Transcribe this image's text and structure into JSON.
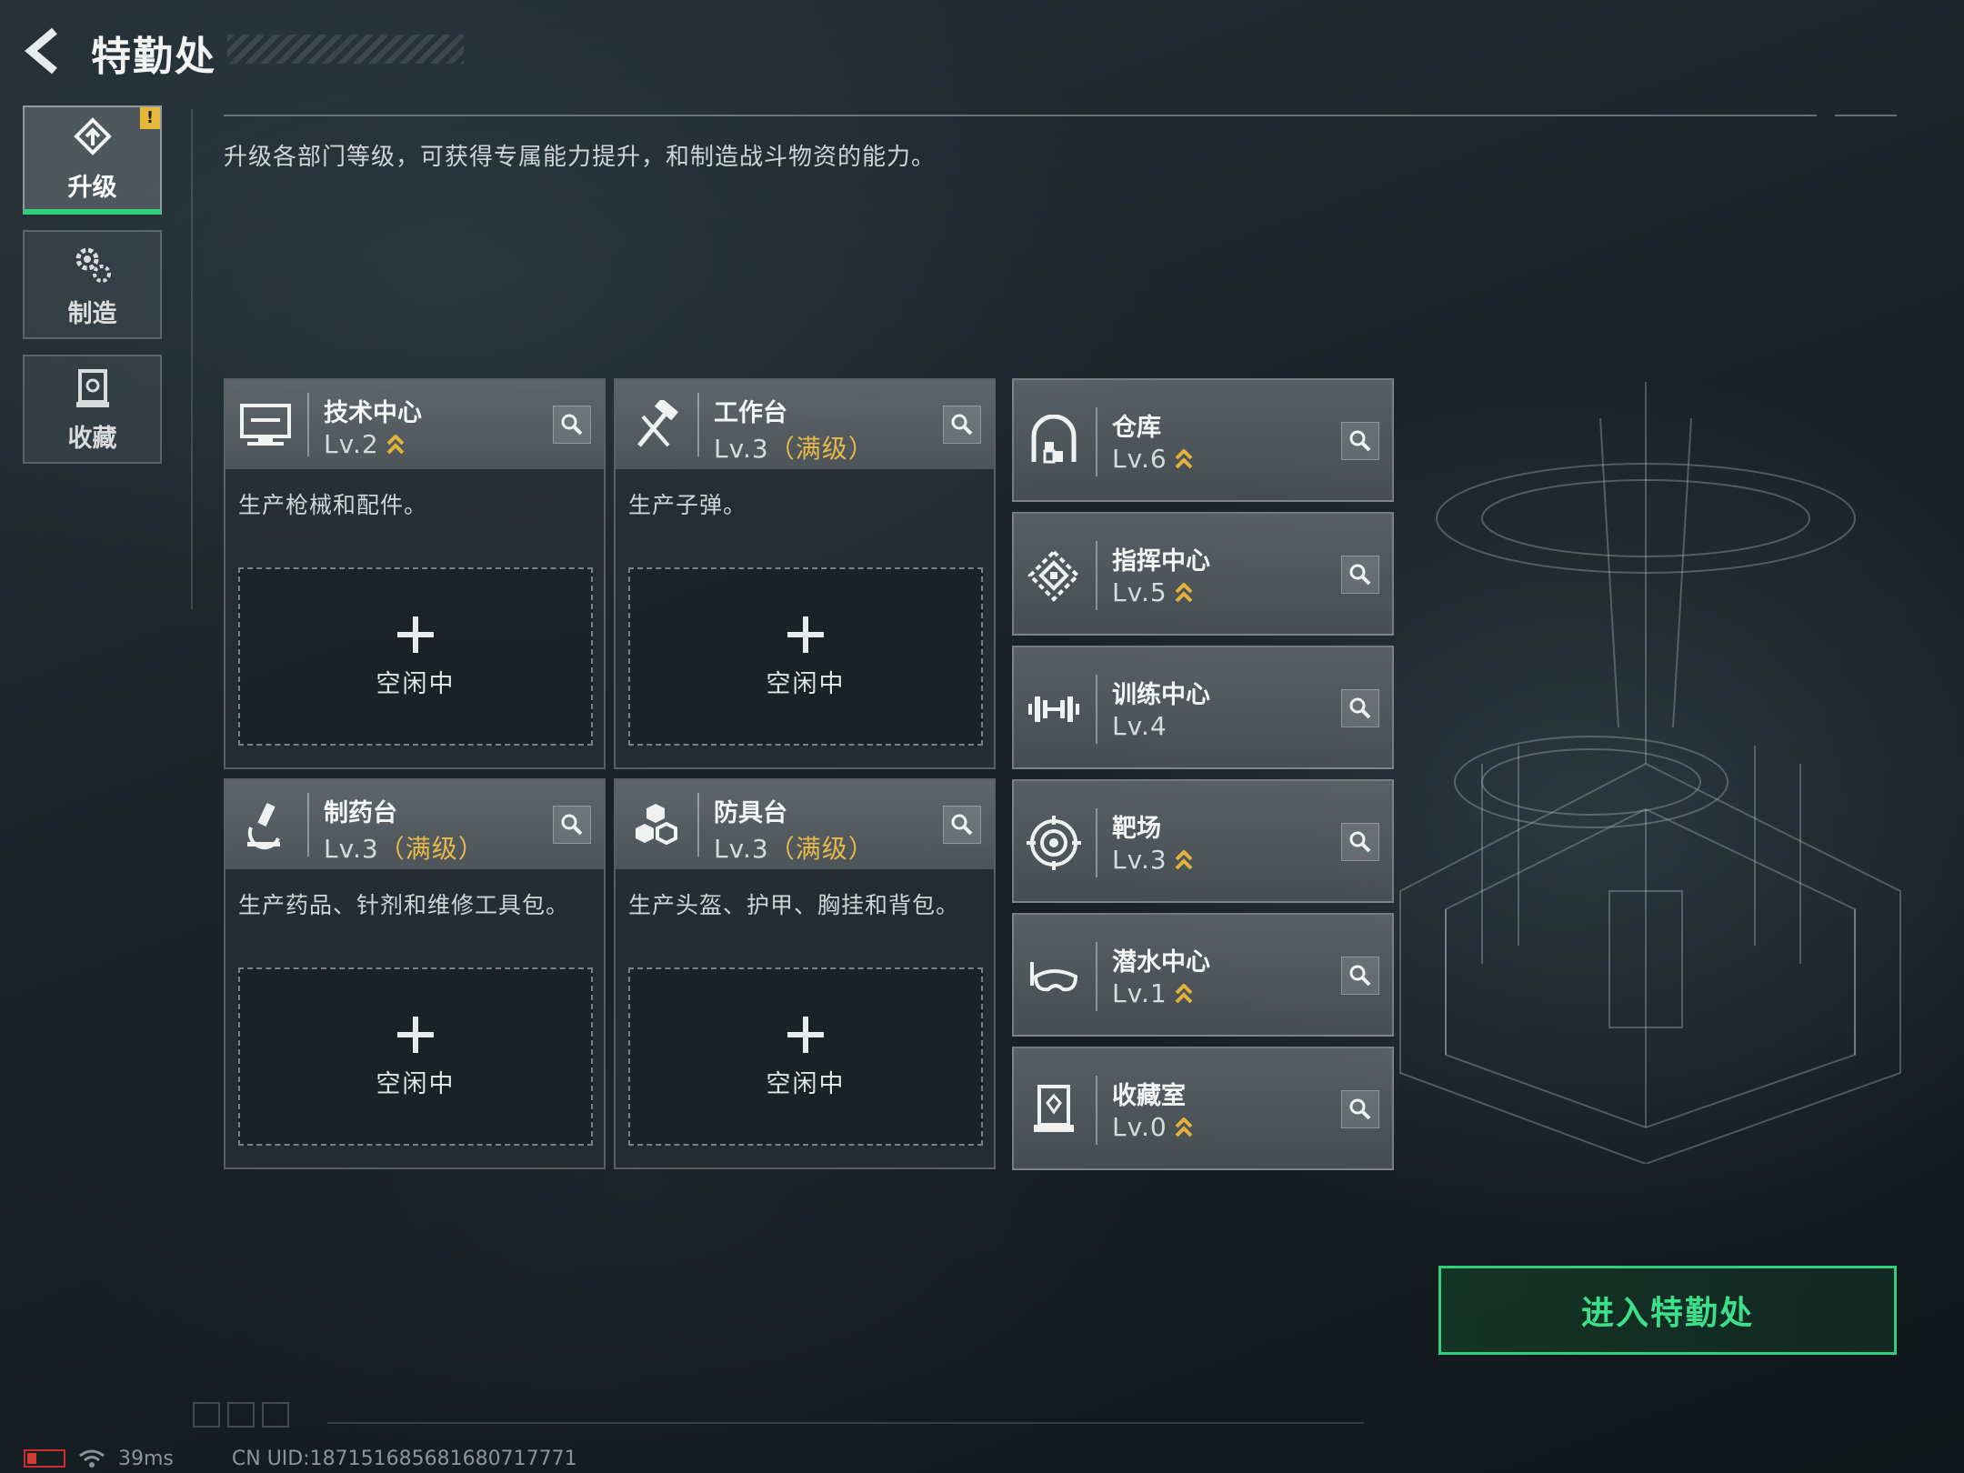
{
  "header": {
    "title": "特勤处"
  },
  "nav": {
    "tabs": [
      {
        "label": "升级",
        "icon": "upgrade-icon",
        "active": true,
        "badge": "!"
      },
      {
        "label": "制造",
        "icon": "gears-icon",
        "active": false
      },
      {
        "label": "收藏",
        "icon": "collection-icon",
        "active": false
      }
    ]
  },
  "description": "升级各部门等级，可获得专属能力提升，和制造战斗物资的能力。",
  "production": [
    {
      "name": "技术中心",
      "level": "Lv.2",
      "max_label": "",
      "upgradable": true,
      "desc": "生产枪械和配件。",
      "slot_label": "空闲中",
      "icon": "monitor-icon"
    },
    {
      "name": "工作台",
      "level": "Lv.3",
      "max_label": "（满级）",
      "upgradable": false,
      "desc": "生产子弹。",
      "slot_label": "空闲中",
      "icon": "hammer-icon"
    },
    {
      "name": "制药台",
      "level": "Lv.3",
      "max_label": "（满级）",
      "upgradable": false,
      "desc": "生产药品、针剂和维修工具包。",
      "slot_label": "空闲中",
      "icon": "microscope-icon"
    },
    {
      "name": "防具台",
      "level": "Lv.3",
      "max_label": "（满级）",
      "upgradable": false,
      "desc": "生产头盔、护甲、胸挂和背包。",
      "slot_label": "空闲中",
      "icon": "armor-blocks-icon"
    }
  ],
  "facilities": [
    {
      "name": "仓库",
      "level": "Lv.6",
      "upgradable": true,
      "icon": "warehouse-icon"
    },
    {
      "name": "指挥中心",
      "level": "Lv.5",
      "upgradable": true,
      "icon": "command-icon"
    },
    {
      "name": "训练中心",
      "level": "Lv.4",
      "upgradable": false,
      "icon": "dumbbell-icon"
    },
    {
      "name": "靶场",
      "level": "Lv.3",
      "upgradable": true,
      "icon": "target-icon"
    },
    {
      "name": "潜水中心",
      "level": "Lv.1",
      "upgradable": true,
      "icon": "dive-mask-icon"
    },
    {
      "name": "收藏室",
      "level": "Lv.0",
      "upgradable": true,
      "icon": "collection-room-icon"
    }
  ],
  "enter_button": "进入特勤处",
  "footer": {
    "ping": "39ms",
    "uid": "CN UID:187151685681680717771"
  },
  "colors": {
    "accent_green": "#2fd07a",
    "max_level_gold": "#e8b84a",
    "upgrade_chevron": "#e3b23c",
    "battery_red": "#d23a34"
  }
}
